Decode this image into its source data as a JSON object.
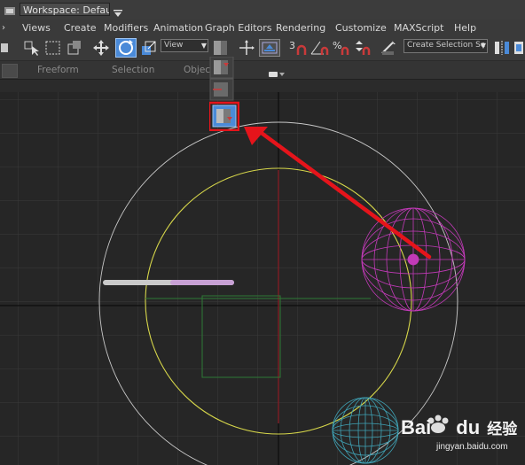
{
  "titlebar": {
    "workspace": "Workspace: Default",
    "dropdown_icon": "caret-down"
  },
  "menu": {
    "items": [
      "Views",
      "Create",
      "Modifiers",
      "Animation",
      "Graph Editors",
      "Rendering",
      "Customize",
      "MAXScript",
      "Help"
    ]
  },
  "toolbar": {
    "view_dropdown": "View",
    "selection_set_dropdown": "Create Selection Se",
    "snap_label": "3",
    "percent_label": "%"
  },
  "ribbon": {
    "tabs": [
      "Freeform",
      "Selection",
      "Objec"
    ]
  },
  "annotation": {
    "highlight_color": "#e5141b",
    "arrow_color": "#e5141b"
  },
  "watermark": {
    "brand": "Bai",
    "brand2": "du",
    "cn": "经验",
    "url": "jingyan.baidu.com"
  },
  "colors": {
    "accent_blue": "#4a8ad8",
    "grid": "#3a3a3a",
    "outer_circle": "#c8c8c8",
    "yellow_circle": "#d6d64a",
    "magenta_sphere": "#c23ab8",
    "cyan_sphere": "#3fa2b5",
    "green_box": "#2e7a35"
  }
}
